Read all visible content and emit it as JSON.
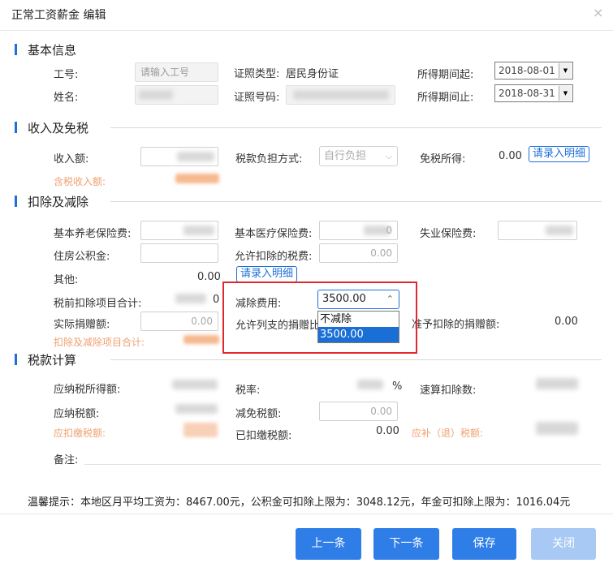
{
  "window": {
    "title": "正常工资薪金 编辑",
    "close": "×"
  },
  "sections": {
    "basic": "基本信息",
    "income": "收入及免税",
    "deduct": "扣除及减除",
    "tax": "税款计算"
  },
  "basic": {
    "id_label": "工号:",
    "id_placeholder": "请输入工号",
    "name_label": "姓名:",
    "cert_type_label": "证照类型:",
    "cert_type_value": "居民身份证",
    "cert_no_label": "证照号码:",
    "period_start_label": "所得期间起:",
    "period_start_value": "2018-08-01",
    "period_end_label": "所得期间止:",
    "period_end_value": "2018-08-31"
  },
  "income": {
    "income_label": "收入额:",
    "tax_burden_label": "税款负担方式:",
    "tax_burden_value": "自行负担",
    "exempt_label": "免税所得:",
    "exempt_value": "0.00",
    "enter_detail": "请录入明细",
    "taxable_income_label": "含税收入额:"
  },
  "deduct": {
    "pension_label": "基本养老保险费:",
    "medical_label": "基本医疗保险费:",
    "medical_value_fragment": "0",
    "unemployment_label": "失业保险费:",
    "housing_label": "住房公积金:",
    "allowed_tax_label": "允许扣除的税费:",
    "allowed_tax_value": "0.00",
    "other_label": "其他:",
    "other_value": "0.00",
    "enter_detail": "请录入明细",
    "pretax_total_label": "税前扣除项目合计:",
    "pretax_total_fragment": "0",
    "reduction_label": "减除费用:",
    "reduction_value": "3500.00",
    "reduction_options": [
      "不减除",
      "3500.00"
    ],
    "donation_label": "实际捐赠额:",
    "donation_value": "0.00",
    "donation_ratio_label": "允许列支的捐赠比",
    "allowed_donation_label": "准予扣除的捐赠额:",
    "allowed_donation_value": "0.00",
    "deduct_total_label": "扣除及减除项目合计:"
  },
  "tax": {
    "taxable_label": "应纳税所得额:",
    "rate_label": "税率:",
    "rate_unit": "%",
    "quick_label": "速算扣除数:",
    "tax_payable_label": "应纳税额:",
    "reduction_label": "减免税额:",
    "reduction_value": "0.00",
    "withhold_label": "应扣缴税额:",
    "withheld_label": "已扣缴税额:",
    "withheld_value": "0.00",
    "refund_label": "应补（退）税额:",
    "remark_label": "备注:"
  },
  "note": "温馨提示：本地区月平均工资为：8467.00元，公积金可扣除上限为：3048.12元，年金可扣除上限为：1016.04元",
  "buttons": {
    "prev": "上一条",
    "next": "下一条",
    "save": "保存",
    "close": "关闭"
  },
  "colors": {
    "accent": "#2f7ee8",
    "highlight_box": "#e0282c",
    "orange_label": "#f0a070"
  }
}
